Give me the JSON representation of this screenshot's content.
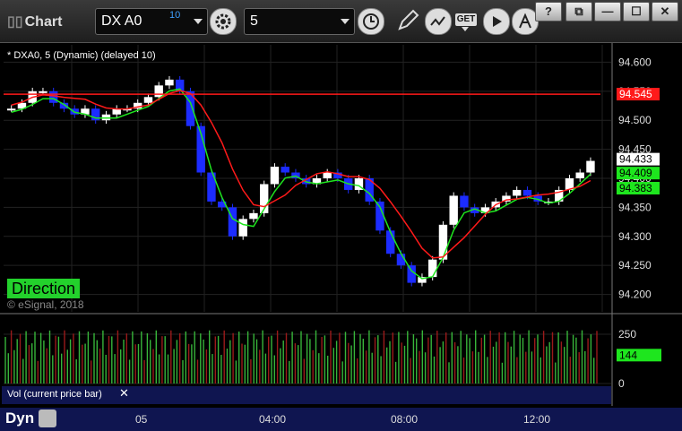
{
  "window": {
    "title": "Chart",
    "symbol": "DX A0",
    "symbol_badge": "10",
    "interval": "5",
    "get_label": "GET",
    "btn_help": "?",
    "btn_restore": "⧉",
    "btn_min": "—",
    "btn_max": "☐",
    "btn_close": "✕"
  },
  "chart": {
    "label": "* DXA0, 5 (Dynamic) (delayed 10)",
    "direction": "Direction",
    "copyright": "© eSignal, 2018",
    "price_axis": [
      "94.600",
      "94.550",
      "94.500",
      "94.450",
      "94.400",
      "94.350",
      "94.300",
      "94.250",
      "94.200"
    ],
    "red_level": "94.545",
    "last_price": "94.433",
    "green_1": "94.409",
    "green_2": "94.383",
    "colors": {
      "red": "#ff1a1a",
      "green": "#1ee61e",
      "candle_up": "#ffffff",
      "candle_down": "#1c2cff"
    }
  },
  "volume": {
    "label": "Vol (current price bar)",
    "close": "✕",
    "axis": [
      "250",
      "0"
    ],
    "current": "144"
  },
  "timebar": {
    "dyn": "Dyn",
    "labels": [
      "05",
      "04:00",
      "08:00",
      "12:00"
    ]
  },
  "chart_data": {
    "type": "candlestick",
    "ylim": [
      94.17,
      94.63
    ],
    "price_bars": [
      94.52,
      94.53,
      94.55,
      94.55,
      94.53,
      94.52,
      94.51,
      94.52,
      94.5,
      94.51,
      94.52,
      94.52,
      94.53,
      94.54,
      94.56,
      94.57,
      94.55,
      94.49,
      94.41,
      94.36,
      94.35,
      94.3,
      94.33,
      94.34,
      94.39,
      94.42,
      94.41,
      94.4,
      94.39,
      94.4,
      94.41,
      94.4,
      94.38,
      94.4,
      94.36,
      94.31,
      94.27,
      94.25,
      94.22,
      94.23,
      94.26,
      94.32,
      94.37,
      94.35,
      94.34,
      94.35,
      94.36,
      94.37,
      94.38,
      94.37,
      94.36,
      94.36,
      94.38,
      94.4,
      94.41,
      94.43
    ],
    "volume_ylim": [
      0,
      300
    ]
  }
}
